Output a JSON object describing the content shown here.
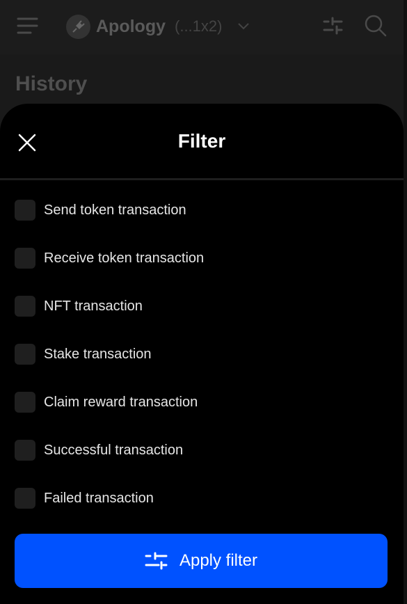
{
  "header": {
    "account_name": "Apology",
    "account_address": "(...1x2)"
  },
  "page_title": "History",
  "filter": {
    "title": "Filter",
    "options": [
      {
        "label": "Send token transaction",
        "checked": false
      },
      {
        "label": "Receive token transaction",
        "checked": false
      },
      {
        "label": "NFT transaction",
        "checked": false
      },
      {
        "label": "Stake transaction",
        "checked": false
      },
      {
        "label": "Claim reward transaction",
        "checked": false
      },
      {
        "label": "Successful transaction",
        "checked": false
      },
      {
        "label": "Failed transaction",
        "checked": false
      }
    ],
    "apply_label": "Apply filter"
  }
}
